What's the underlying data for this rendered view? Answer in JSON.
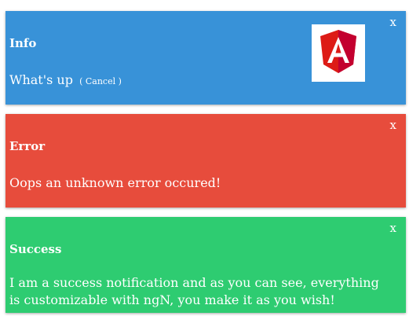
{
  "colors": {
    "info": "#3892d8",
    "error": "#e74c3c",
    "success": "#2ecc71"
  },
  "notifications": [
    {
      "type": "info",
      "close_label": "x",
      "title": "Info",
      "message": "What's up",
      "action_label": "( Cancel )",
      "icon": "angular-logo-icon"
    },
    {
      "type": "error",
      "close_label": "x",
      "title": "Error",
      "message": "Oops an unknown error occured!"
    },
    {
      "type": "success",
      "close_label": "x",
      "title": "Success",
      "message": "I am a success notification and as you can see, everything is customizable with ngN, you make it as you wish!"
    }
  ]
}
